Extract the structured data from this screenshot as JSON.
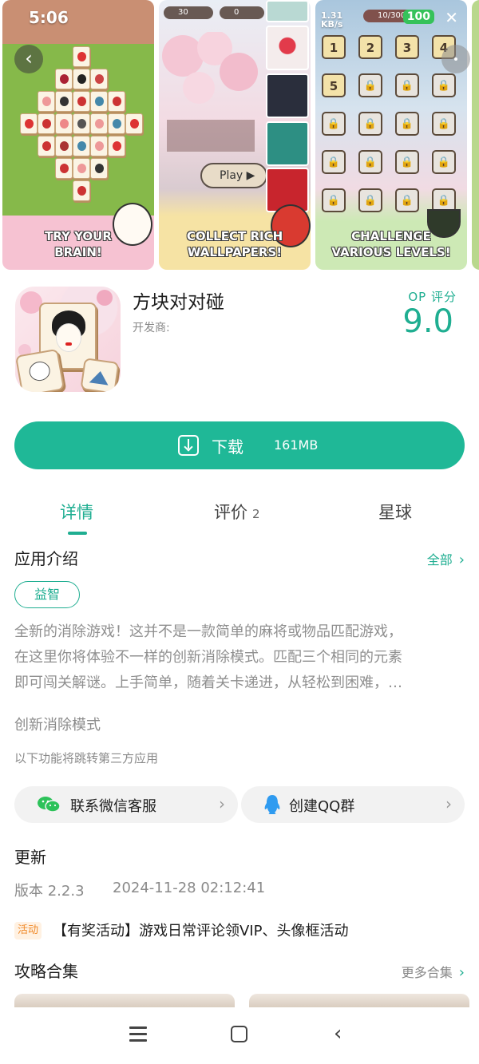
{
  "status_bar": {
    "time": "5:06",
    "net_speed": "1.31",
    "net_unit": "KB/s",
    "battery": "100"
  },
  "screenshots": {
    "shot1_caption_1": "TRY YOUR",
    "shot1_caption_2": "BRAIN!",
    "shot2_caption_1": "COLLECT RICH",
    "shot2_caption_2": "WALLPAPERS!",
    "shot2_coins": "30",
    "shot2_gems": "0",
    "shot2_play": "Play",
    "shot3_caption_1": "CHALLENGE",
    "shot3_caption_2": "VARIOUS LEVELS!",
    "shot3_progress": "10/3000",
    "levels": [
      "1",
      "2",
      "3",
      "4",
      "5"
    ]
  },
  "app": {
    "name": "方块对对碰",
    "developer_label": "开发商:",
    "score_label": "OP 评分",
    "score": "9.0"
  },
  "download": {
    "label": "下载",
    "size": "161MB"
  },
  "tabs": [
    {
      "label": "详情",
      "count": ""
    },
    {
      "label": "评价",
      "count": "2"
    },
    {
      "label": "星球",
      "count": ""
    }
  ],
  "intro": {
    "title": "应用介绍",
    "all_link": "全部",
    "tag": "益智",
    "description_lines": [
      "全新的消除游戏！这并不是一款简单的麻将或物品匹配游戏，",
      "在这里你将体验不一样的创新消除模式。匹配三个相同的元素",
      "即可闯关解谜。上手简单，随着关卡递进，从轻松到困难，…"
    ],
    "subtitle": "创新消除模式",
    "third_party_note": "以下功能将跳转第三方应用",
    "wechat_label": "联系微信客服",
    "qq_label": "创建QQ群"
  },
  "update": {
    "title": "更新",
    "version": "版本 2.2.3",
    "date": "2024-11-28 02:12:41",
    "event_badge": "活动",
    "event_text": "【有奖活动】游戏日常评论领VIP、头像框活动"
  },
  "guides": {
    "title": "攻略合集",
    "more_link": "更多合集"
  },
  "colors": {
    "accent": "#1fb897",
    "accent_text": "#1fae91",
    "event": "#f08a2a"
  }
}
